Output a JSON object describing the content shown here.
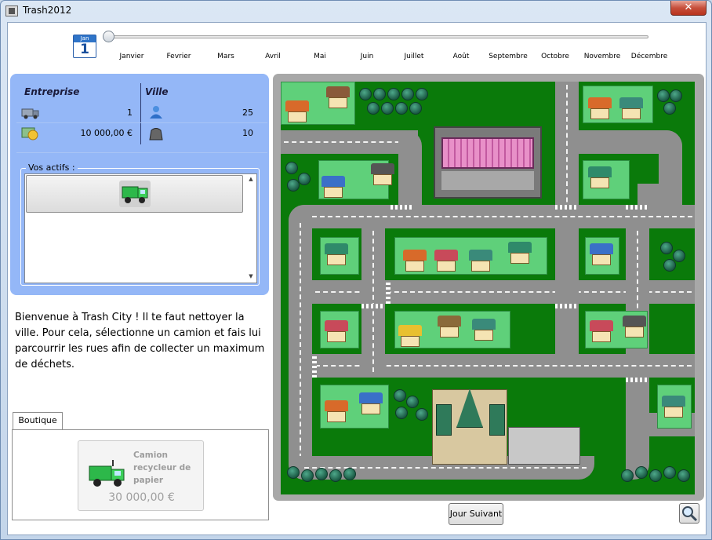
{
  "window": {
    "title": "Trash2012",
    "close_symbol": "✕"
  },
  "calendar": {
    "month_abbr": "Jan",
    "day": "1"
  },
  "timeline": {
    "position_fraction": 0.0,
    "months": [
      "Janvier",
      "Fevrier",
      "Mars",
      "Avril",
      "Mai",
      "Juin",
      "Juillet",
      "Août",
      "Septembre",
      "Octobre",
      "Novembre",
      "Décembre"
    ]
  },
  "stats": {
    "company_header": "Entreprise",
    "city_header": "Ville",
    "trucks": "1",
    "money": "10 000,00 €",
    "population": "25",
    "garbage": "10"
  },
  "assets": {
    "title": "Vos actifs :",
    "items": [
      {
        "icon": "green-truck-icon"
      }
    ]
  },
  "welcome_text": "Bienvenue à Trash City ! Il te faut nettoyer la ville. Pour cela, sélectionne un camion et fais lui parcourrir les rues afin de collecter un maximum de déchets.",
  "shop": {
    "tab_label": "Boutique",
    "item": {
      "name": "Camion recycleur de papier",
      "price": "30 000,00 €",
      "icon": "recycling-truck-icon"
    }
  },
  "buttons": {
    "next_day": "Jour Suivant",
    "zoom_icon": "magnifier-icon"
  },
  "colors": {
    "panel_blue": "#94b7f7",
    "grass": "#0a7a0a",
    "road": "#8f8f8f",
    "truck_green": "#2db84a"
  }
}
